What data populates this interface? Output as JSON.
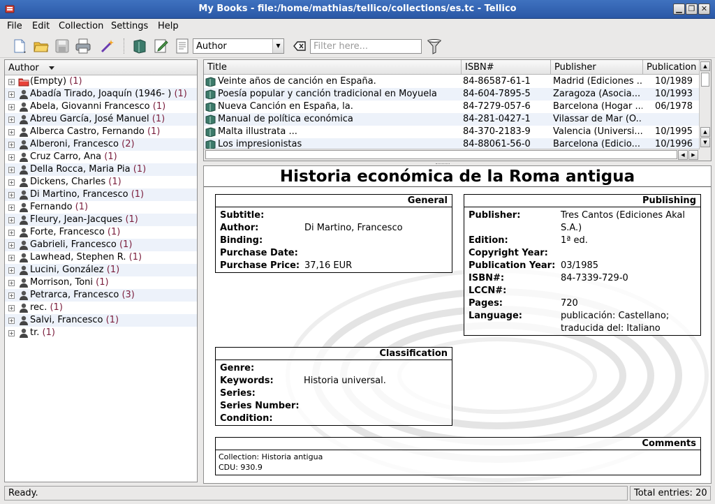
{
  "window": {
    "title": "My Books - file:/home/mathias/tellico/collections/es.tc - Tellico"
  },
  "menu": [
    "File",
    "Edit",
    "Collection",
    "Settings",
    "Help"
  ],
  "toolbar": {
    "group_by_value": "Author",
    "filter_placeholder": "Filter here..."
  },
  "tree": {
    "header": "Author",
    "items": [
      {
        "name": "(Empty)",
        "count": "(1)"
      },
      {
        "name": "Abadía Tirado, Joaquín (1946- )",
        "count": "(1)"
      },
      {
        "name": "Abela, Giovanni Francesco",
        "count": "(1)"
      },
      {
        "name": "Abreu García, José Manuel",
        "count": "(1)"
      },
      {
        "name": "Alberca Castro, Fernando",
        "count": "(1)"
      },
      {
        "name": "Alberoni, Francesco",
        "count": "(2)"
      },
      {
        "name": "Cruz Carro, Ana",
        "count": "(1)"
      },
      {
        "name": "Della Rocca, Maria Pia",
        "count": "(1)"
      },
      {
        "name": "Dickens, Charles",
        "count": "(1)"
      },
      {
        "name": "Di Martino, Francesco",
        "count": "(1)"
      },
      {
        "name": "Fernando",
        "count": "(1)"
      },
      {
        "name": "Fleury, Jean-Jacques",
        "count": "(1)"
      },
      {
        "name": "Forte, Francesco",
        "count": "(1)"
      },
      {
        "name": "Gabrieli, Francesco",
        "count": "(1)"
      },
      {
        "name": "Lawhead, Stephen R.",
        "count": "(1)"
      },
      {
        "name": "Lucini, González",
        "count": "(1)"
      },
      {
        "name": "Morrison, Toni",
        "count": "(1)"
      },
      {
        "name": "Petrarca, Francesco",
        "count": "(3)"
      },
      {
        "name": "rec.",
        "count": "(1)"
      },
      {
        "name": "Salvi, Francesco",
        "count": "(1)"
      },
      {
        "name": "tr.",
        "count": "(1)"
      }
    ]
  },
  "list": {
    "columns": [
      "Title",
      "ISBN#",
      "Publisher",
      "Publication Y"
    ],
    "rows": [
      {
        "title": "Veinte años de canción en España.",
        "isbn": "84-86587-61-1",
        "publisher": "Madrid (Ediciones ...",
        "year": "10/1989"
      },
      {
        "title": "Poesía popular y canción tradicional en Moyuela",
        "isbn": "84-604-7895-5",
        "publisher": "Zaragoza (Asocia...",
        "year": "10/1993"
      },
      {
        "title": "Nueva Canción en España, la.",
        "isbn": "84-7279-057-6",
        "publisher": "Barcelona (Hogar ...",
        "year": "06/1978"
      },
      {
        "title": "Manual de política económica",
        "isbn": "84-281-0427-1",
        "publisher": "Vilassar de Mar (O...",
        "year": ""
      },
      {
        "title": "Malta illustrata ...",
        "isbn": "84-370-2183-9",
        "publisher": "Valencia (Universi...",
        "year": "10/1995"
      },
      {
        "title": "Los impresionistas",
        "isbn": "84-88061-56-0",
        "publisher": "Barcelona (Edicio...",
        "year": "10/1996"
      }
    ]
  },
  "detail": {
    "title": "Historia económica de la Roma antigua",
    "general": {
      "header": "General",
      "fields": [
        {
          "label": "Subtitle:",
          "value": ""
        },
        {
          "label": "Author:",
          "value": "Di Martino, Francesco"
        },
        {
          "label": "Binding:",
          "value": ""
        },
        {
          "label": "Purchase Date:",
          "value": ""
        },
        {
          "label": "Purchase Price:",
          "value": "37,16 EUR"
        }
      ]
    },
    "publishing": {
      "header": "Publishing",
      "publisher_label": "Publisher:",
      "publisher_line1": "Tres Cantos (Ediciones Akal",
      "publisher_line2": "S.A.)",
      "fields": [
        {
          "label": "Edition:",
          "value": "1ª ed."
        },
        {
          "label": "Copyright Year:",
          "value": ""
        },
        {
          "label": "Publication Year:",
          "value": "03/1985"
        },
        {
          "label": "ISBN#:",
          "value": "84-7339-729-0"
        },
        {
          "label": "LCCN#:",
          "value": ""
        },
        {
          "label": "Pages:",
          "value": "720"
        }
      ],
      "language_label": "Language:",
      "language_line1": "publicación: Castellano;",
      "language_line2": "traducida del: Italiano"
    },
    "classification": {
      "header": "Classification",
      "fields": [
        {
          "label": "Genre:",
          "value": ""
        },
        {
          "label": "Keywords:",
          "value": "Historia universal."
        },
        {
          "label": "Series:",
          "value": ""
        },
        {
          "label": "Series Number:",
          "value": ""
        },
        {
          "label": "Condition:",
          "value": ""
        }
      ]
    },
    "comments": {
      "header": "Comments",
      "line1": "Collection: Historia antigua",
      "line2": "CDU: 930.9"
    }
  },
  "status": {
    "message": "Ready.",
    "total": "Total entries: 20"
  }
}
